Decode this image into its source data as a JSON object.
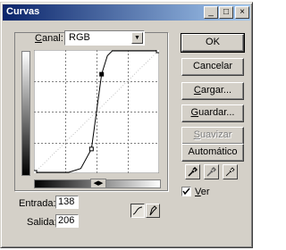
{
  "window": {
    "title": "Curvas"
  },
  "titlebar_buttons": {
    "minimize": "_",
    "maximize": "□",
    "close": "×"
  },
  "channel": {
    "label_underlined": "C",
    "label_rest": "anal:",
    "value": "RGB"
  },
  "buttons": {
    "ok": "OK",
    "cancel": "Cancelar",
    "load_u": "C",
    "load_rest": "argar...",
    "save_u": "G",
    "save_rest": "uardar...",
    "smooth_u": "S",
    "smooth_rest": "uavizar",
    "auto": "Automático"
  },
  "input": {
    "label": "Entrada:",
    "value": "138"
  },
  "output": {
    "label": "Salida:",
    "value": "206"
  },
  "preview": {
    "label_underlined": "V",
    "label_rest": "er",
    "checked": true
  },
  "curve_points": [
    {
      "input": 0,
      "output": 0
    },
    {
      "input": 117,
      "output": 49
    },
    {
      "input": 138,
      "output": 206
    },
    {
      "input": 255,
      "output": 255
    }
  ],
  "colors": {
    "titlebar_start": "#0a246a",
    "titlebar_end": "#a6caf0",
    "face": "#d4d0c8"
  }
}
